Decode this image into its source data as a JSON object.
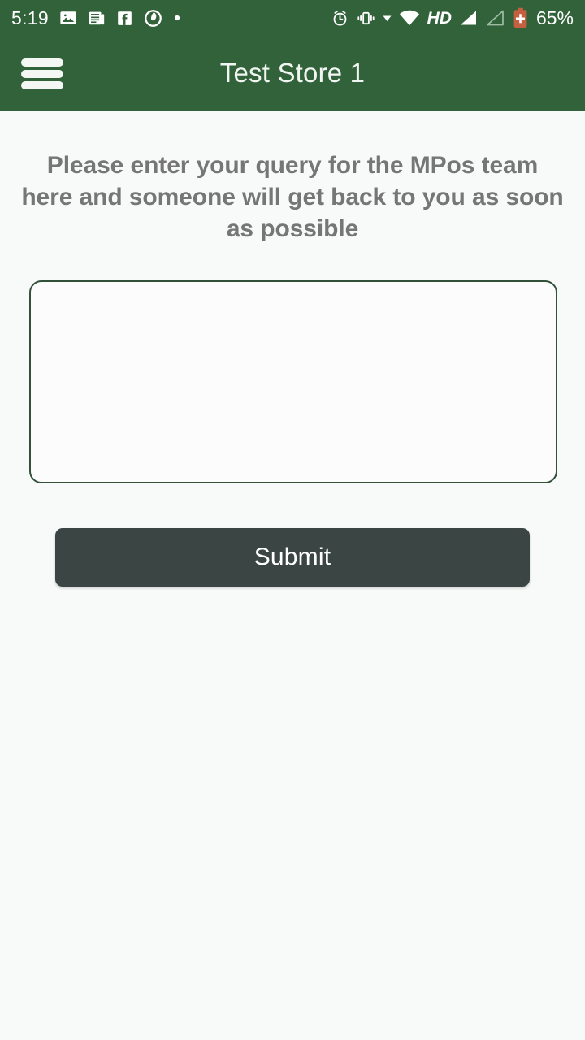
{
  "status_bar": {
    "time": "5:19",
    "battery_percent": "65%",
    "hd_label": "HD",
    "left_icons": [
      {
        "name": "photos-icon"
      },
      {
        "name": "news-article-icon"
      },
      {
        "name": "facebook-icon"
      },
      {
        "name": "vodafone-icon"
      },
      {
        "name": "more-notifications-dot-icon"
      }
    ],
    "right_icons": [
      {
        "name": "alarm-clock-icon"
      },
      {
        "name": "vibrate-mode-icon"
      },
      {
        "name": "dropdown-caret-icon"
      },
      {
        "name": "wifi-icon"
      },
      {
        "name": "signal-bars-sim1-icon"
      },
      {
        "name": "signal-bars-sim2-icon"
      },
      {
        "name": "battery-icon"
      }
    ]
  },
  "app_bar": {
    "menu_icon": "hamburger-menu-icon",
    "title": "Test Store 1"
  },
  "main": {
    "instruction": "Please enter your query for the MPos team here and someone will get back to you as soon as possible",
    "query_field": {
      "value": "",
      "placeholder": ""
    },
    "submit_label": "Submit"
  },
  "colors": {
    "header_green": "#31623a",
    "page_background": "#f8f9f9",
    "field_border": "#33503a",
    "submit_background": "#3b4644",
    "instruction_text": "#767676",
    "battery_red": "#c4603f"
  }
}
